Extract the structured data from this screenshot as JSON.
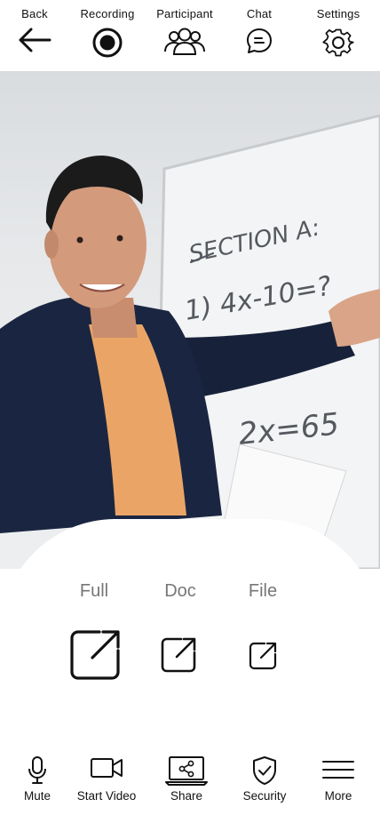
{
  "topbar": {
    "back": "Back",
    "recording": "Recording",
    "participant": "Participant",
    "chat": "Chat",
    "settings": "Settings"
  },
  "share_options": {
    "full": "Full",
    "doc": "Doc",
    "file": "File"
  },
  "toolbar": {
    "mute": "Mute",
    "start_video": "Start Video",
    "share": "Share",
    "security": "Security",
    "more": "More"
  },
  "video": {
    "whiteboard_line1": "SECTION A:",
    "whiteboard_line2": "1) 4x-10=?",
    "whiteboard_line3": "2x=65"
  },
  "icons": [
    "back-arrow-icon",
    "record-icon",
    "participants-icon",
    "chat-icon",
    "gear-icon",
    "share-out-icon",
    "microphone-icon",
    "video-camera-icon",
    "share-screen-icon",
    "shield-check-icon",
    "menu-icon"
  ]
}
